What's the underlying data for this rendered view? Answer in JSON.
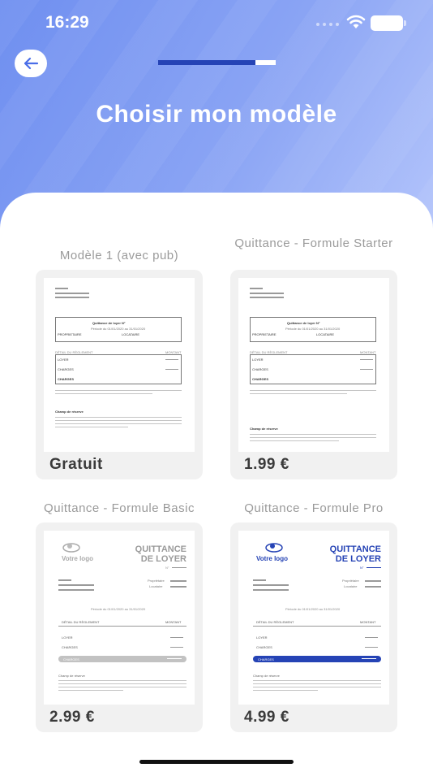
{
  "status": {
    "time": "16:29"
  },
  "colors": {
    "accent": "#2543b5",
    "hero_start": "#6f8ff0",
    "hero_end": "#b3c4fb",
    "card_bg": "#f1f1f1"
  },
  "progress": {
    "value": 0.83
  },
  "page": {
    "title": "Choisir mon modèle"
  },
  "models": [
    {
      "title": "Modèle 1 (avec pub)",
      "price": "Gratuit"
    },
    {
      "title": "Quittance - Formule Starter",
      "price": "1.99 €"
    },
    {
      "title": "Quittance - Formule Basic",
      "price": "2.99 €"
    },
    {
      "title": "Quittance - Formule Pro",
      "price": "4.99 €"
    }
  ],
  "doc_simple": {
    "heading": "Quittance de loyer N°",
    "subheading": "Période du 01/01/2020 au 31/01/2020",
    "owner": "PROPRIETAIRE",
    "tenant": "LOCATAIRE",
    "detail": "DÉTAIL DU RÈGLEMENT",
    "amount": "MONTANT",
    "rent": "LOYER",
    "charges": "CHARGES",
    "total": "CHARGES",
    "notes": "Champ de réserve"
  },
  "doc_branded": {
    "logo": "Votre logo",
    "title_line1": "QUITTANCE",
    "title_line2": "DE LOYER",
    "number": "N°",
    "owner": "Propriétaire",
    "tenant": "Locataire",
    "period": "Période du 01/01/2020 au 31/01/2020",
    "detail": "DÉTAIL DU RÈGLEMENT",
    "amount": "MONTANT",
    "rent": "LOYER",
    "charges": "CHARGES",
    "total": "CHARGES",
    "notes": "Champ de réserve"
  }
}
